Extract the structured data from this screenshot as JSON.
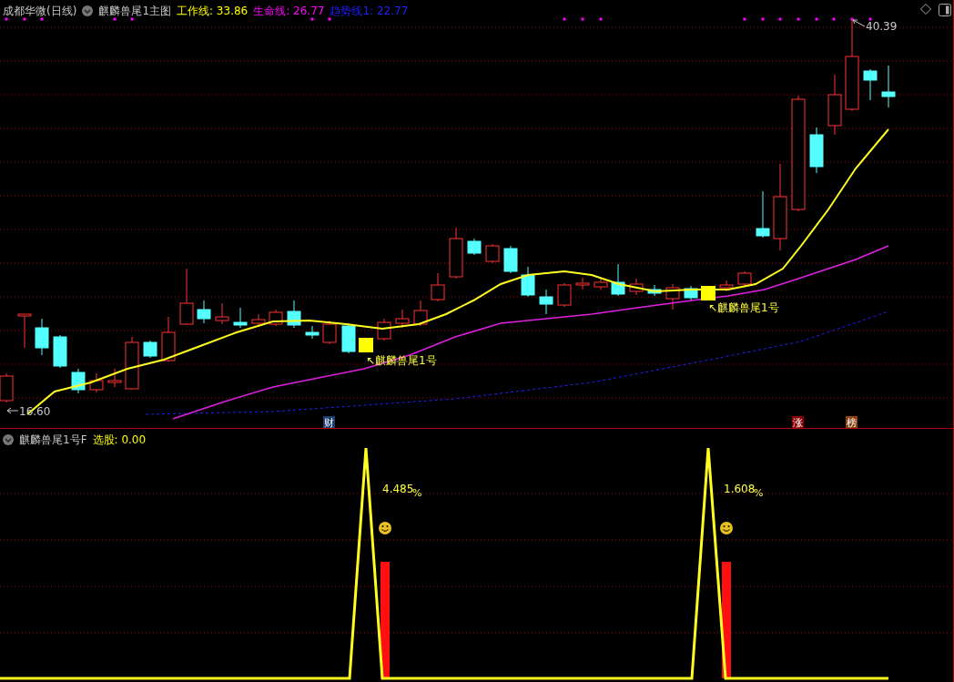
{
  "main_panel": {
    "header": {
      "stock": "成都华微(日线)",
      "indicator": "麒麟兽尾1主图",
      "lines": [
        {
          "text": "工作线: 33.86",
          "color": "#ffff00"
        },
        {
          "text": "生命线: 26.77",
          "color": "#ff00ff"
        },
        {
          "text": "趋势线1: 22.77",
          "color": "#2020ff"
        }
      ]
    },
    "price_labels": {
      "high": "40.39",
      "low": "16.60"
    },
    "signals": [
      {
        "text": "↖麒麟兽尾1号"
      },
      {
        "text": "↖麒麟兽尾1号"
      }
    ],
    "badges": [
      {
        "text": "财",
        "color": "#1c3f6e"
      },
      {
        "text": "涨",
        "color": "#8b0000"
      },
      {
        "text": "榜",
        "color": "#8b4513"
      }
    ]
  },
  "sub_panel": {
    "header": {
      "indicator": "麒麟兽尾1号F",
      "reading": "选股: 0.00"
    },
    "readings": [
      {
        "value": "4.485",
        "unit": "%"
      },
      {
        "value": "1.608",
        "unit": "%"
      }
    ]
  }
}
